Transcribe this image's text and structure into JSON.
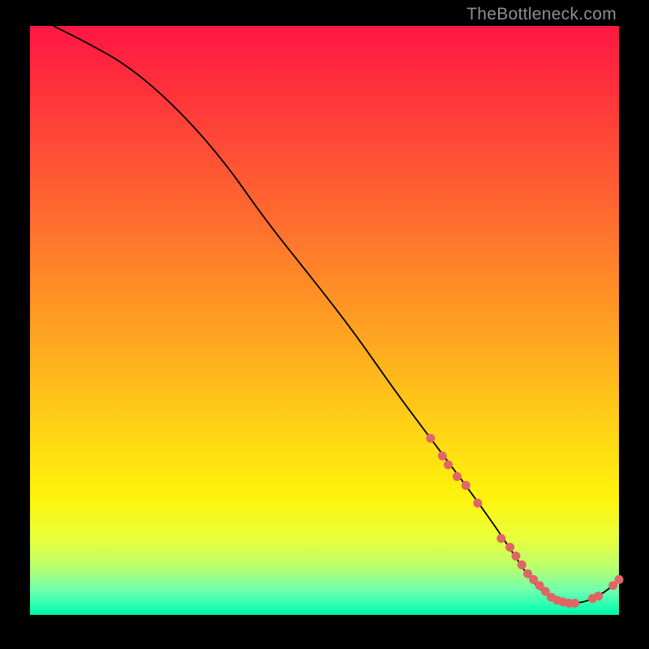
{
  "watermark": "TheBottleneck.com",
  "chart_data": {
    "type": "line",
    "title": "",
    "xlabel": "",
    "ylabel": "",
    "xlim": [
      0,
      100
    ],
    "ylim": [
      0,
      100
    ],
    "grid": false,
    "legend": false,
    "x": [
      4,
      10,
      17,
      25,
      33,
      40,
      48,
      55,
      62,
      68,
      74,
      79,
      81,
      83,
      85,
      87,
      89,
      91,
      93,
      95,
      97,
      99,
      100
    ],
    "y": [
      100,
      97,
      93,
      86,
      77,
      67,
      57,
      48,
      38,
      30,
      22,
      15,
      12,
      9,
      6,
      4,
      2.5,
      2,
      2,
      2.5,
      3.5,
      5,
      6
    ],
    "highlight_points": {
      "comment": "salmon dots along the lower right of the curve",
      "x": [
        68,
        70,
        71,
        72.5,
        74,
        76,
        80,
        81.5,
        82.5,
        83.5,
        84.5,
        85.5,
        86.5,
        87.5,
        88.5,
        89.5,
        90.5,
        91.5,
        92.5,
        95.5,
        96.5,
        99,
        100
      ],
      "y": [
        30,
        27,
        25.5,
        23.5,
        22,
        19,
        13,
        11.5,
        10,
        8.5,
        7,
        6,
        5,
        4,
        3,
        2.5,
        2.2,
        2,
        2,
        2.8,
        3.2,
        5,
        6
      ]
    },
    "colors": {
      "gradient_top": "#ff1744",
      "gradient_mid": "#ffd814",
      "gradient_bottom": "#00f0a0",
      "curve": "#000000",
      "dots": "#e06666",
      "frame": "#000000"
    }
  }
}
